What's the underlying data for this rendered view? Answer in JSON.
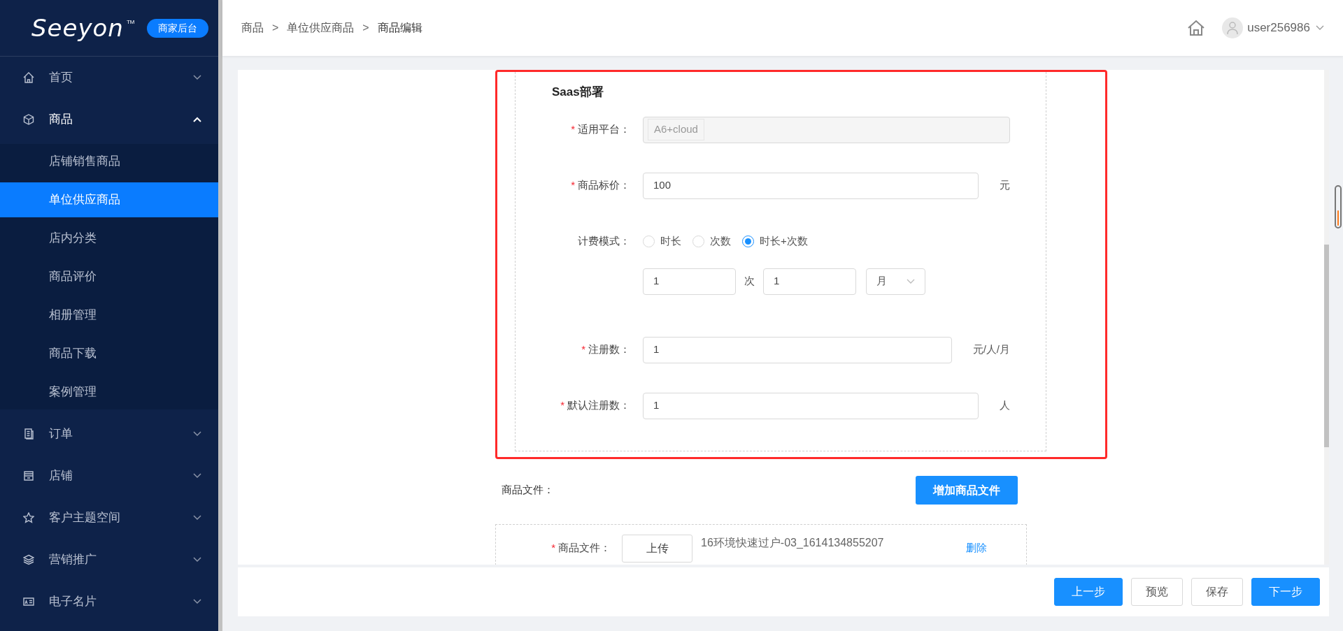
{
  "logo": {
    "text": "Seeyon",
    "tm": "TM",
    "badge": "商家后台"
  },
  "sidebar": {
    "items": [
      {
        "label": "首页",
        "expanded": false
      },
      {
        "label": "商品",
        "expanded": true,
        "children": [
          {
            "label": "店铺销售商品",
            "selected": false
          },
          {
            "label": "单位供应商品",
            "selected": true
          },
          {
            "label": "店内分类",
            "selected": false
          },
          {
            "label": "商品评价",
            "selected": false
          },
          {
            "label": "相册管理",
            "selected": false
          },
          {
            "label": "商品下载",
            "selected": false
          },
          {
            "label": "案例管理",
            "selected": false
          }
        ]
      },
      {
        "label": "订单",
        "expanded": false
      },
      {
        "label": "店铺",
        "expanded": false
      },
      {
        "label": "客户主题空间",
        "expanded": false
      },
      {
        "label": "营销推广",
        "expanded": false
      },
      {
        "label": "电子名片",
        "expanded": false
      }
    ]
  },
  "breadcrumb": {
    "items": [
      "商品",
      "单位供应商品",
      "商品编辑"
    ],
    "separators": [
      ">",
      ">"
    ]
  },
  "user": {
    "name": "user256986"
  },
  "section": {
    "title": "Saas部署",
    "fields": [
      {
        "kind": "tags",
        "required_mark": "*",
        "label": "适用平台：",
        "tags": [
          "A6+cloud"
        ],
        "disabled": true
      },
      {
        "kind": "input",
        "required_mark": "*",
        "label": "商品标价：",
        "value": "100",
        "unit": "元"
      },
      {
        "kind": "radio",
        "label": "计费模式：",
        "options": [
          {
            "label": "时长",
            "selected": false
          },
          {
            "label": "次数",
            "selected": false
          },
          {
            "label": "时长+次数",
            "selected": true
          }
        ]
      },
      {
        "kind": "combo",
        "first": "1",
        "between": "次",
        "second": "1",
        "select": "月"
      },
      {
        "kind": "input",
        "required_mark": "*",
        "label": "注册数：",
        "value": "1",
        "unit": "元/人/月"
      },
      {
        "kind": "input",
        "required_mark": "*",
        "label": "默认注册数：",
        "value": "1",
        "unit": "人"
      }
    ]
  },
  "files": {
    "label": "商品文件：",
    "add_button": "增加商品文件",
    "items": [
      {
        "required_mark": "*",
        "label": "商品文件：",
        "upload_button": "上传",
        "filename": "16环境快速过户-03_1614134855207",
        "delete_link": "删除"
      }
    ]
  },
  "footer_buttons": [
    {
      "label": "上一步",
      "kind": "primary"
    },
    {
      "label": "预览",
      "kind": "default"
    },
    {
      "label": "保存",
      "kind": "default"
    },
    {
      "label": "下一步",
      "kind": "primary"
    }
  ]
}
